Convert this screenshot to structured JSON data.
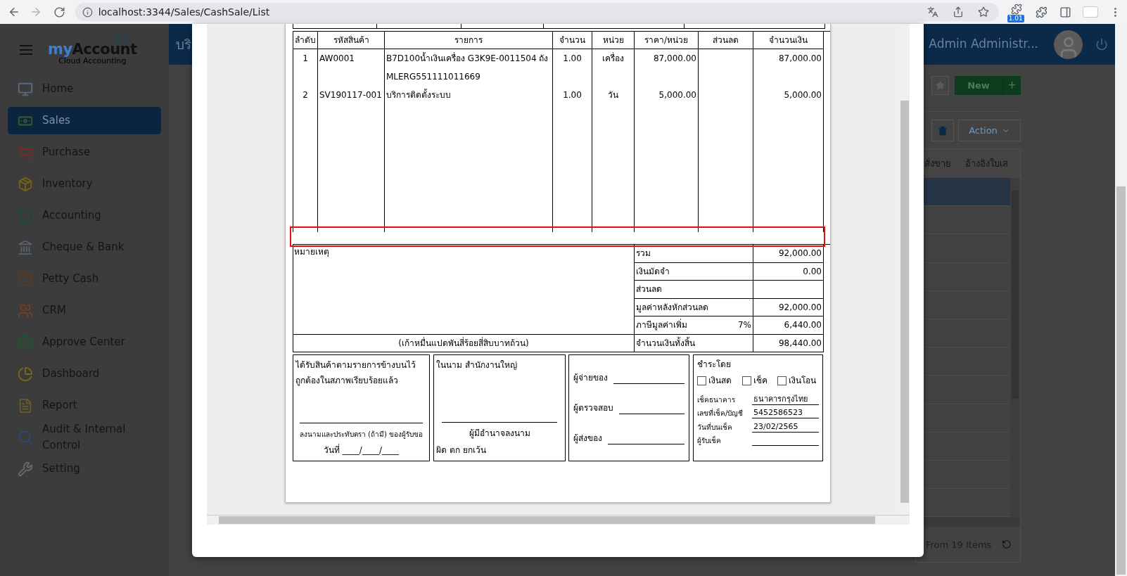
{
  "browser": {
    "url": "localhost:3344/Sales/CashSale/List",
    "extension_badge": "1.01"
  },
  "sidebar": {
    "logo": {
      "title_part_1": "my",
      "title_part_2": "Account",
      "tagline": "Cloud Accounting"
    },
    "items": [
      {
        "label": "Home",
        "selected": false
      },
      {
        "label": "Sales",
        "selected": true
      },
      {
        "label": "Purchase",
        "selected": false
      },
      {
        "label": "Inventory",
        "selected": false
      },
      {
        "label": "Accounting",
        "selected": false
      },
      {
        "label": "Cheque & Bank",
        "selected": false
      },
      {
        "label": "Petty Cash",
        "selected": false
      },
      {
        "label": "CRM",
        "selected": false
      },
      {
        "label": "Approve Center",
        "selected": false
      },
      {
        "label": "Dashboard",
        "selected": false
      },
      {
        "label": "Report",
        "selected": false
      },
      {
        "label": "Audit & Internal Control",
        "selected": false
      },
      {
        "label": "Setting",
        "selected": false
      }
    ]
  },
  "header": {
    "title_fragment": "บริ",
    "user_name": "Admin Administr..."
  },
  "toolbar": {
    "new_button": "New",
    "add_symbol": "+",
    "action_button": "Action"
  },
  "grid": {
    "columns": [
      "สั่งขาย",
      "อ้างอิงใบเส"
    ],
    "rows": [
      {
        "selected": true
      },
      {
        "selected": false
      },
      {
        "selected": false
      },
      {
        "selected": false
      },
      {
        "selected": false
      },
      {
        "selected": false
      },
      {
        "selected": false
      },
      {
        "selected": false
      },
      {
        "selected": false
      },
      {
        "selected": false
      },
      {
        "selected": false
      },
      {
        "selected": false
      }
    ],
    "footer": "From 19 Items"
  },
  "document": {
    "items_table": {
      "columns": [
        "ลำดับ",
        "รหัสสินค้า",
        "รายการ",
        "จำนวน",
        "หน่วย",
        "ราคา/หน่วย",
        "ส่วนลด",
        "จำนวนเงิน"
      ],
      "rows": [
        {
          "no": "1",
          "code": "AW0001",
          "description": "B7D100น้ำเงินเครื่อง G3K9E-0011504 ถัง MLERG551111011669",
          "quantity": "1.00",
          "unit": "เครื่อง",
          "unit_price": "87,000.00",
          "amount": "87,000.00"
        },
        {
          "no": "2",
          "code": "SV190117-001",
          "description": "บริการติดตั้งระบบ",
          "quantity": "1.00",
          "unit": "วัน",
          "unit_price": "5,000.00",
          "amount": "5,000.00"
        }
      ]
    },
    "summary": {
      "remark_label": "หมายเหตุ",
      "amount_in_words": "(เก้าหมื่นแปดพันสี่ร้อยสี่สิบบาทถ้วน)",
      "lines": [
        {
          "label": "รวม",
          "value": "92,000.00"
        },
        {
          "label": "เงินมัดจำ",
          "value": "0.00"
        },
        {
          "label": "ส่วนลด"
        },
        {
          "label": "มูลค่าหลังหักส่วนลด",
          "value": "92,000.00"
        },
        {
          "label": "ภาษีมูลค่าเพิ่ม",
          "rate": "7%",
          "value": "6,440.00"
        },
        {
          "label": "จำนวนเงินทั้งสิ้น",
          "value": "98,440.00"
        }
      ]
    },
    "receiver_box": {
      "lines": [
        "ได้รับสินค้าตามรายการข้างบนไว้",
        "ถูกต้องในสภาพเรียบร้อยแล้ว"
      ],
      "signature_caption": "ลงนามและประทับตรา (ถ้ามี) ของผู้รับขอ",
      "date_line": "วันที่ ____/____/____"
    },
    "company_box": {
      "title": "ในนาม สำนักงานใหญ่",
      "signature_caption": "ผู้มีอำนาจลงนาม",
      "note": "ผิด ตก ยกเว้น"
    },
    "signers": [
      "ผู้จ่ายของ",
      "ผู้ตรวจสอบ",
      "ผู้ส่งของ"
    ],
    "payment": {
      "title": "ชำระโดย",
      "methods": [
        {
          "label": "เงินสด",
          "checked": false
        },
        {
          "label": "เช็ค",
          "checked": false
        },
        {
          "label": "เงินโอน",
          "checked": false
        }
      ],
      "fields": [
        {
          "label": "เช็คธนาคาร",
          "value": "ธนาคารกรุงไทย"
        },
        {
          "label": "เลขที่เช็ค/บัญชี",
          "value": "5452586523"
        },
        {
          "label": "วันที่บนเช็ค",
          "value": "23/02/2565"
        },
        {
          "label": "ผู้รับเช็ค"
        }
      ]
    }
  }
}
